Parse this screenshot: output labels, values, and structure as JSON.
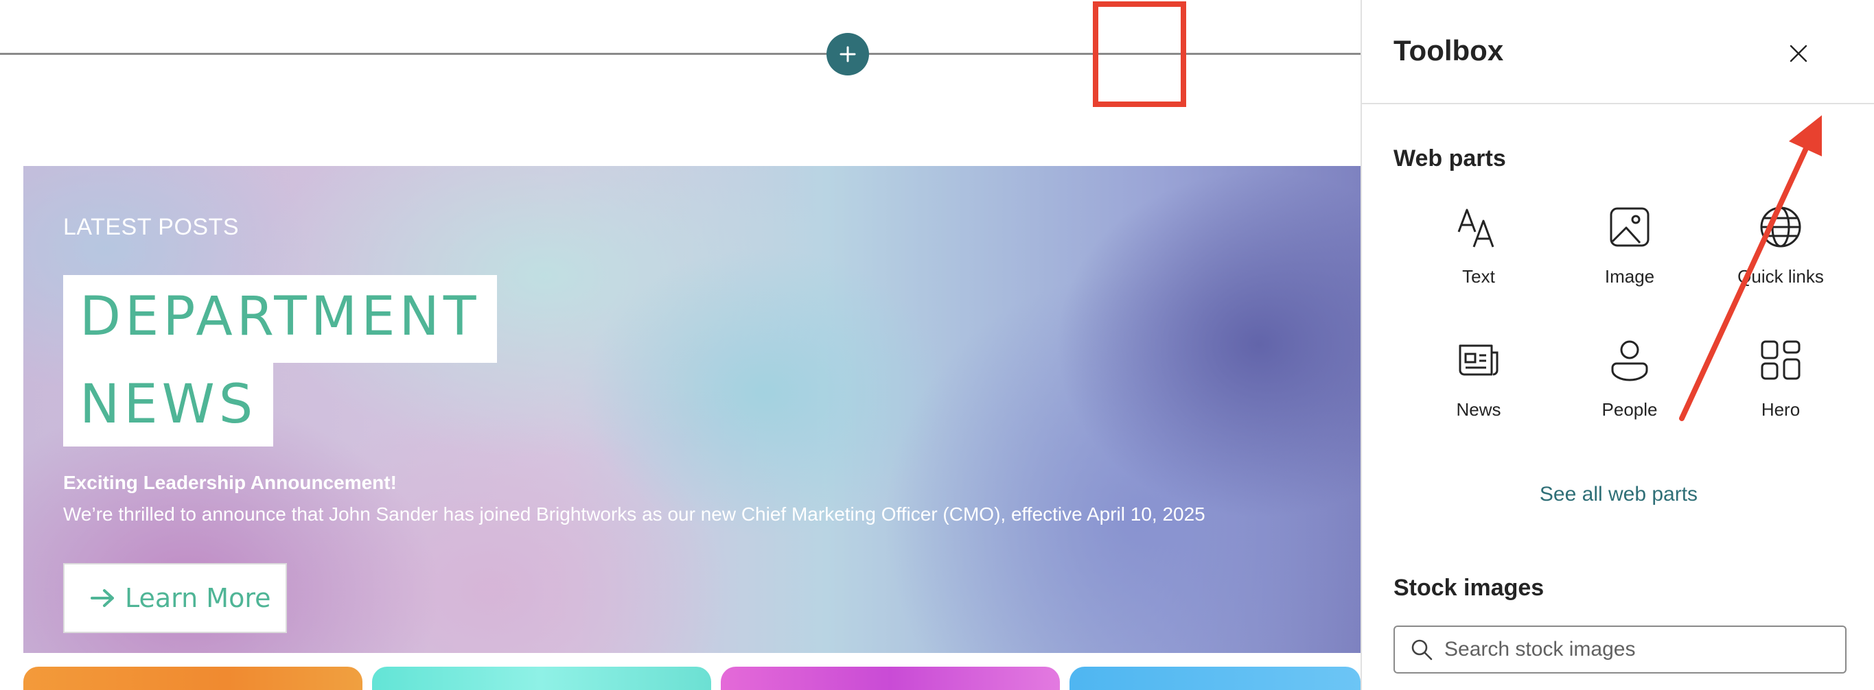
{
  "canvas": {
    "add_section_icon": "plus-icon"
  },
  "hero": {
    "eyebrow": "LATEST POSTS",
    "title_line1": "DEPARTMENT",
    "title_line2": "NEWS",
    "subhead": "Exciting Leadership Announcement!",
    "body": "We’re thrilled to announce that John Sander has joined Brightworks as our new Chief Marketing Officer (CMO), effective April 10, 2025",
    "cta_label": "Learn More",
    "cta_icon": "arrow-right-icon"
  },
  "toolbox": {
    "title": "Toolbox",
    "close_icon": "close-icon",
    "web_parts_heading": "Web parts",
    "web_parts": [
      {
        "label": "Text",
        "icon": "text-icon"
      },
      {
        "label": "Image",
        "icon": "image-icon"
      },
      {
        "label": "Quick links",
        "icon": "globe-icon"
      },
      {
        "label": "News",
        "icon": "news-icon"
      },
      {
        "label": "People",
        "icon": "person-icon"
      },
      {
        "label": "Hero",
        "icon": "hero-grid-icon"
      }
    ],
    "see_all_label": "See all web parts",
    "stock_images_heading": "Stock images",
    "search_placeholder": "Search stock images",
    "search_icon": "search-icon"
  },
  "colors": {
    "accent_teal": "#2f6f77",
    "title_green": "#4fb596",
    "annotation_red": "#e8412f"
  }
}
